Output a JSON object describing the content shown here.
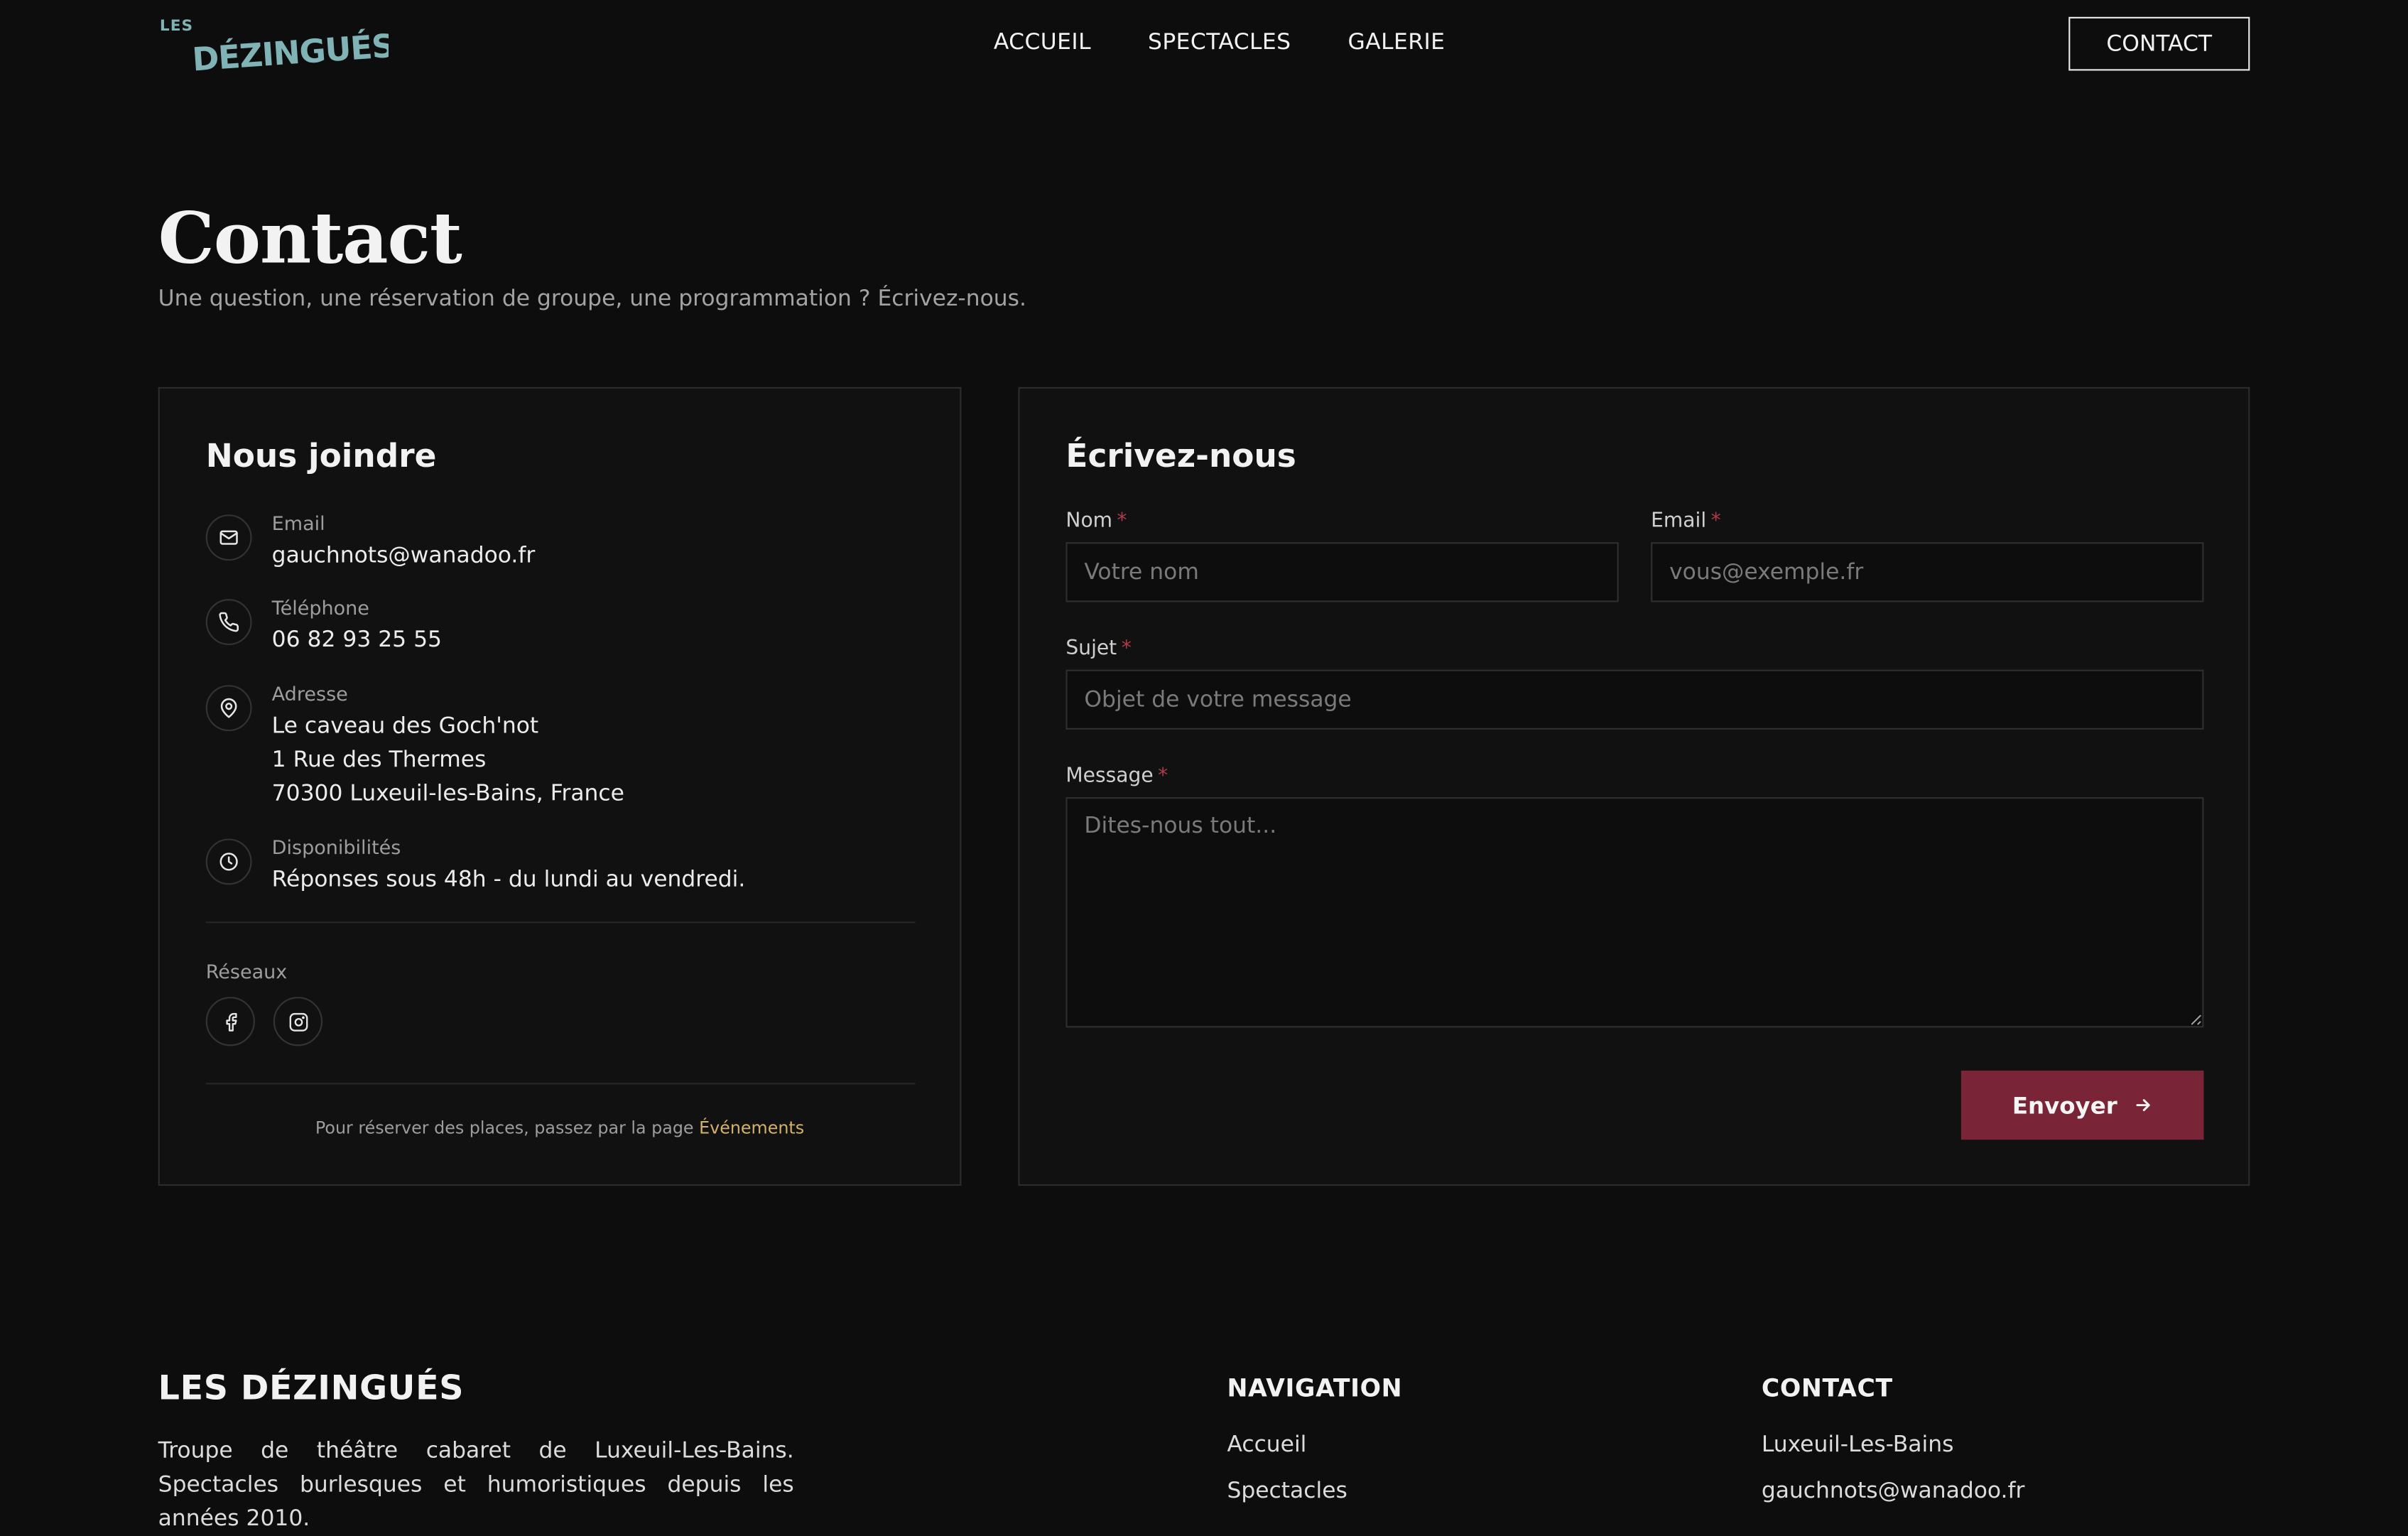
{
  "header": {
    "logo_small": "LES",
    "logo_main": "DÉZINGUÉS",
    "logo_color": "#7fb3b5",
    "nav": [
      {
        "label": "ACCUEIL"
      },
      {
        "label": "SPECTACLES"
      },
      {
        "label": "GALERIE"
      }
    ],
    "contact_label": "CONTACT"
  },
  "hero": {
    "title": "Contact",
    "subtitle": "Une question, une réservation de groupe, une programmation ? Écrivez-nous."
  },
  "info": {
    "title": "Nous joindre",
    "items": [
      {
        "icon": "mail-icon",
        "label": "Email",
        "value": "gauchnots@wanadoo.fr"
      },
      {
        "icon": "phone-icon",
        "label": "Téléphone",
        "value": "06 82 93 25 55"
      },
      {
        "icon": "map-pin-icon",
        "label": "Adresse",
        "lines": [
          "Le caveau des Goch'not",
          "1 Rue des Thermes",
          "70300 Luxeuil-les-Bains, France"
        ]
      },
      {
        "icon": "clock-icon",
        "label": "Disponibilités",
        "value": "Réponses sous 48h - du lundi au vendredi."
      }
    ],
    "social_label": "Réseaux",
    "social": [
      {
        "icon": "facebook-icon"
      },
      {
        "icon": "instagram-icon"
      }
    ],
    "note_text": "Pour réserver des places, passez par la page",
    "note_link": "Événements"
  },
  "form": {
    "title": "Écrivez-nous",
    "name_label": "Nom",
    "name_placeholder": "Votre nom",
    "email_label": "Email",
    "email_placeholder": "vous@exemple.fr",
    "subject_label": "Sujet",
    "subject_placeholder": "Objet de votre message",
    "message_label": "Message",
    "message_placeholder": "Dites-nous tout...",
    "required_mark": "*",
    "submit_label": "Envoyer",
    "accent_color": "#7a2537"
  },
  "footer": {
    "brand": "LES DÉZINGUÉS",
    "description": "Troupe de théâtre cabaret de Luxeuil-Les-Bains. Spectacles burlesques et humoristiques depuis les années 2010.",
    "nav_title": "NAVIGATION",
    "nav_links": [
      {
        "label": "Accueil"
      },
      {
        "label": "Spectacles"
      }
    ],
    "contact_title": "CONTACT",
    "contact_lines": [
      {
        "label": "Luxeuil-Les-Bains"
      },
      {
        "label": "gauchnots@wanadoo.fr"
      }
    ]
  }
}
